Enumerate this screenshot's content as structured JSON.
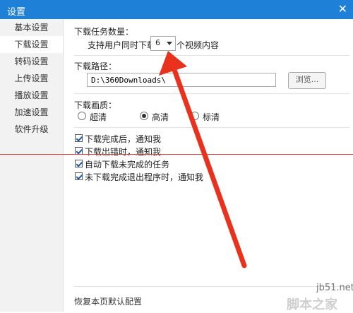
{
  "window": {
    "title": "设置",
    "close_glyph": "✕"
  },
  "sidebar": {
    "items": [
      {
        "label": "基本设置"
      },
      {
        "label": "下载设置",
        "active": true
      },
      {
        "label": "转码设置"
      },
      {
        "label": "上传设置"
      },
      {
        "label": "播放设置"
      },
      {
        "label": "加速设置"
      },
      {
        "label": "软件升级"
      }
    ]
  },
  "tasks": {
    "title": "下载任务数量：",
    "prefix": "支持用户同时下载",
    "count": "6",
    "suffix": "个视频内容"
  },
  "path": {
    "title": "下载路径：",
    "value": "D:\\360Downloads\\",
    "browse_label": "浏览..."
  },
  "quality": {
    "title": "下载画质：",
    "options": [
      {
        "label": "超清",
        "checked": false
      },
      {
        "label": "高清",
        "checked": true
      },
      {
        "label": "标清",
        "checked": false
      }
    ]
  },
  "notify": {
    "options": [
      {
        "label": "下载完成后，通知我",
        "checked": true
      },
      {
        "label": "下载出错时，通知我",
        "checked": true
      },
      {
        "label": "自动下载未完成的任务",
        "checked": true
      },
      {
        "label": "未下载完成退出程序时，通知我",
        "checked": true
      }
    ]
  },
  "footer": {
    "restore_label": "恢复本页默认配置"
  },
  "watermark": {
    "site": "jb51.net",
    "name": "脚本之家"
  },
  "colors": {
    "titlebar": "#1e80d6",
    "annotation": "#e8321e"
  }
}
